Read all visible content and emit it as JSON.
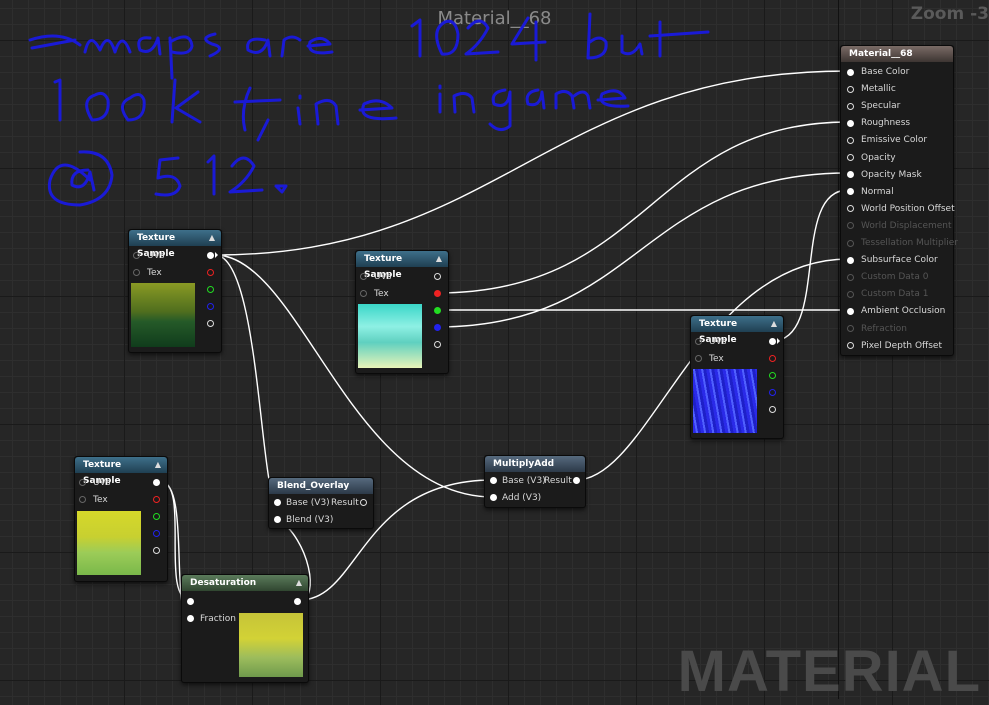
{
  "window_title": "Material__68",
  "zoom_label": "Zoom -3",
  "watermark": "MATERIAL",
  "handwriting": "maps are 1024 but look fine in game @ 512.",
  "nodes": {
    "ts1": {
      "title": "Texture Sample",
      "uvs": "UVs",
      "tex": "Tex"
    },
    "ts2": {
      "title": "Texture Sample",
      "uvs": "UVs",
      "tex": "Tex"
    },
    "ts3": {
      "title": "Texture Sample",
      "uvs": "UVs",
      "tex": "Tex"
    },
    "ts4": {
      "title": "Texture Sample",
      "uvs": "UVs",
      "tex": "Tex"
    },
    "blend": {
      "title": "Blend_Overlay",
      "base": "Base (V3)",
      "result": "Result",
      "blend": "Blend (V3)"
    },
    "madd": {
      "title": "MultiplyAdd",
      "base": "Base (V3)",
      "result": "Result",
      "add": "Add (V3)"
    },
    "desat": {
      "title": "Desaturation",
      "fraction": "Fraction"
    }
  },
  "material": {
    "title": "Material__68",
    "inputs": [
      "Base Color",
      "Metallic",
      "Specular",
      "Roughness",
      "Emissive Color",
      "Opacity",
      "Opacity Mask",
      "Normal",
      "World Position Offset",
      "World Displacement",
      "Tessellation Multiplier",
      "Subsurface Color",
      "Custom Data 0",
      "Custom Data 1",
      "Ambient Occlusion",
      "Refraction",
      "Pixel Depth Offset"
    ],
    "disabled": [
      "World Displacement",
      "Tessellation Multiplier",
      "Custom Data 0",
      "Custom Data 1",
      "Refraction"
    ]
  },
  "colors": {
    "wire": "#ffffff",
    "ink": "#1a1ad6",
    "texture_header": "#2f5f78"
  }
}
